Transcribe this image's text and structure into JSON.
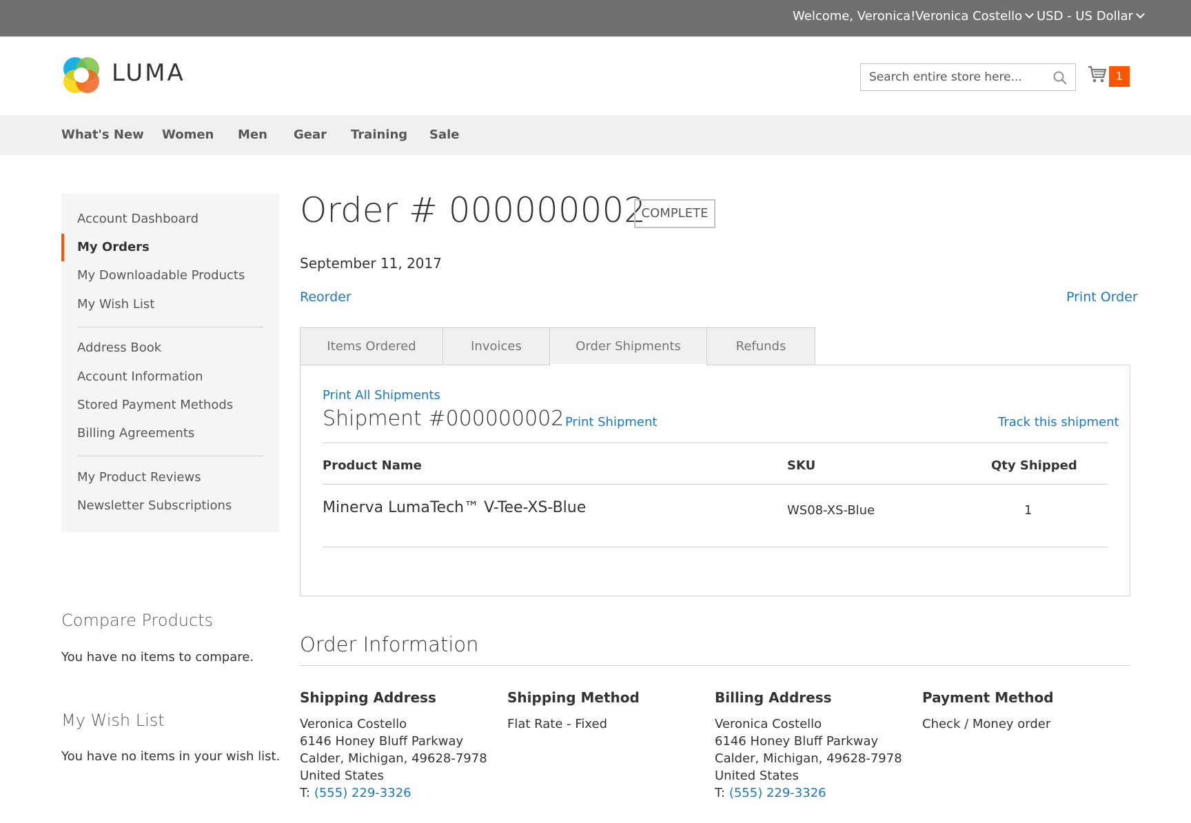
{
  "top_panel": {
    "welcome": "Welcome, Veronica!",
    "account_name": "Veronica Costello",
    "currency": "USD - US Dollar"
  },
  "header": {
    "logo_text": "LUMA",
    "search_placeholder": "Search entire store here...",
    "cart_count": "1"
  },
  "nav": {
    "items": [
      "What's New",
      "Women",
      "Men",
      "Gear",
      "Training",
      "Sale"
    ]
  },
  "sidebar": {
    "items": [
      "Account Dashboard",
      "My Orders",
      "My Downloadable Products",
      "My Wish List",
      "Address Book",
      "Account Information",
      "Stored Payment Methods",
      "Billing Agreements",
      "My Product Reviews",
      "Newsletter Subscriptions"
    ],
    "active": "My Orders"
  },
  "compare": {
    "title": "Compare Products",
    "empty_text": "You have no items to compare."
  },
  "wishlist": {
    "title": "My Wish List",
    "empty_text": "You have no items in your wish list."
  },
  "order": {
    "title": "Order # 000000002",
    "status": "COMPLETE",
    "date": "September 11, 2017",
    "reorder": "Reorder",
    "print_order": "Print Order"
  },
  "tabs": [
    "Items Ordered",
    "Invoices",
    "Order Shipments",
    "Refunds"
  ],
  "shipments": {
    "print_all": "Print All Shipments",
    "title": "Shipment #000000002",
    "print_shipment": "Print Shipment",
    "track": "Track this shipment",
    "columns": [
      "Product Name",
      "SKU",
      "Qty Shipped"
    ],
    "rows": [
      {
        "product": "Minerva LumaTech™ V-Tee-XS-Blue",
        "sku": "WS08-XS-Blue",
        "qty": "1"
      }
    ]
  },
  "order_info": {
    "title": "Order Information",
    "shipping_address": {
      "title": "Shipping Address",
      "name": "Veronica Costello",
      "street": "6146 Honey Bluff Parkway",
      "city": "Calder, Michigan, 49628-7978",
      "country": "United States",
      "phone_prefix": "T:",
      "phone": "(555) 229-3326"
    },
    "shipping_method": {
      "title": "Shipping Method",
      "value": "Flat Rate - Fixed"
    },
    "billing_address": {
      "title": "Billing Address",
      "name": "Veronica Costello",
      "street": "6146 Honey Bluff Parkway",
      "city": "Calder, Michigan, 49628-7978",
      "country": "United States",
      "phone_prefix": "T:",
      "phone": "(555) 229-3326"
    },
    "payment_method": {
      "title": "Payment Method",
      "value": "Check / Money order"
    }
  },
  "colors": {
    "top_panel": "#6e716e",
    "accent": "#ff5501",
    "link": "#1979c3",
    "nav_bg": "#f0f0f0"
  }
}
